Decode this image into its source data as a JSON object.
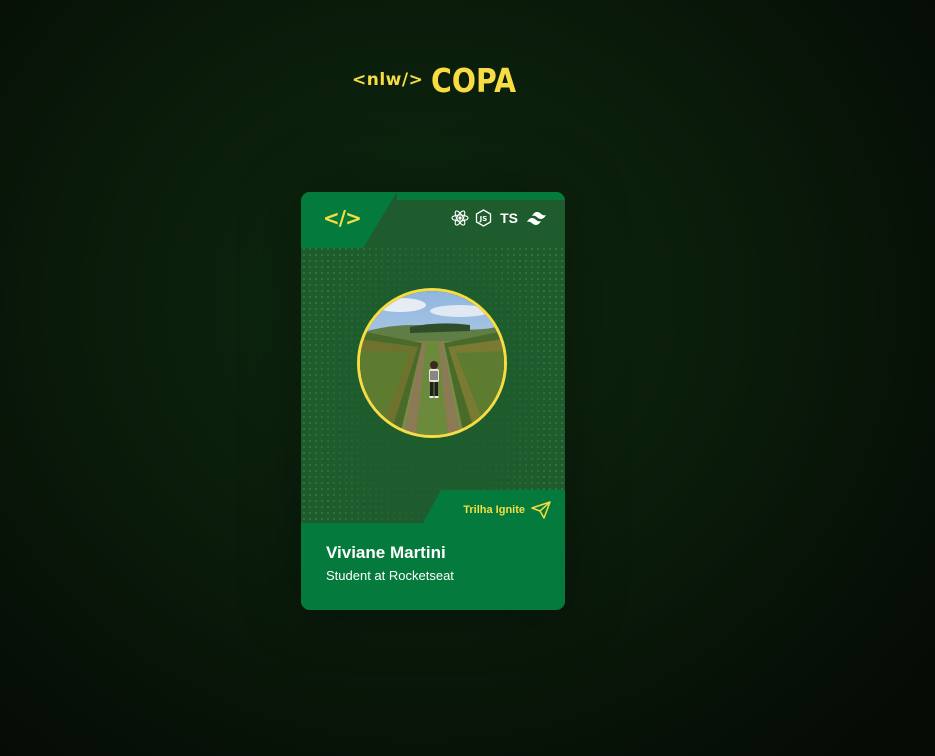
{
  "header": {
    "logo_code": "<nlw/>",
    "logo_copa": "COPA"
  },
  "card": {
    "corner_logo": "</>",
    "tech_icons": [
      "react-icon",
      "nodejs-icon",
      "typescript-icon",
      "tailwind-icon"
    ],
    "ts_label": "TS",
    "track_label": "Trilha Ignite",
    "track_icon": "paper-plane-icon",
    "name": "Viviane Martini",
    "role": "Student at Rocketseat"
  },
  "colors": {
    "accent": "#f7dd43",
    "card_green": "#1e5c2e",
    "card_bright_green": "#047a3c",
    "background": "#0a1d0b"
  }
}
